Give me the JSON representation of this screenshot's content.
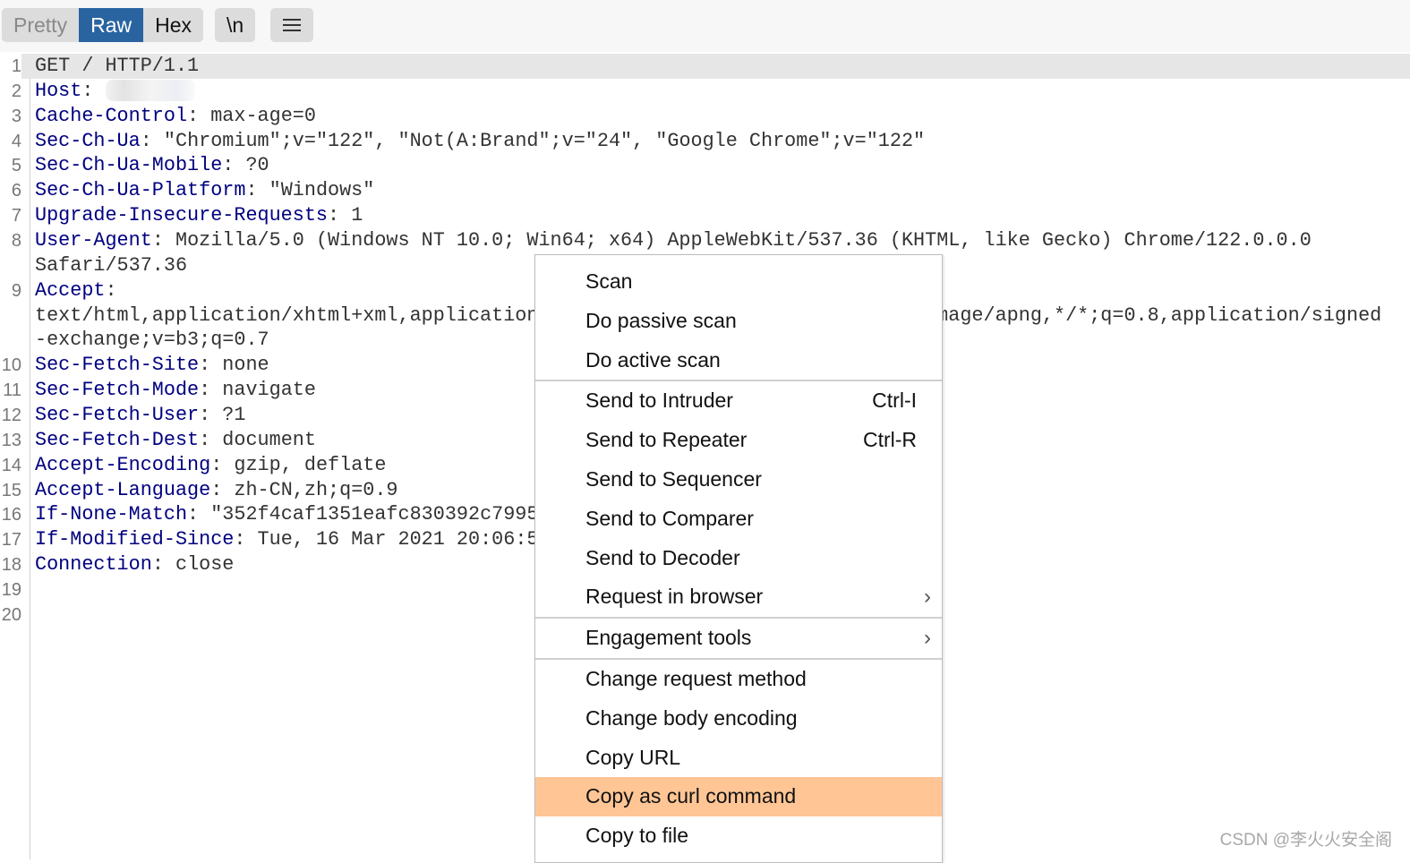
{
  "toolbar": {
    "tabs": [
      {
        "label": "Pretty",
        "active": false
      },
      {
        "label": "Raw",
        "active": true
      },
      {
        "label": "Hex",
        "active": false
      }
    ],
    "newline_label": "\\n",
    "menu_icon": "hamburger-icon"
  },
  "editor": {
    "rows": [
      {
        "num": "1",
        "key": "",
        "sep": "",
        "val": "GET / HTTP/1.1"
      },
      {
        "num": "2",
        "key": "Host",
        "sep": ":",
        "val": "",
        "redacted": true
      },
      {
        "num": "3",
        "key": "Cache-Control",
        "sep": ": ",
        "val": "max-age=0"
      },
      {
        "num": "4",
        "key": "Sec-Ch-Ua",
        "sep": ": ",
        "val": "\"Chromium\";v=\"122\", \"Not(A:Brand\";v=\"24\", \"Google Chrome\";v=\"122\""
      },
      {
        "num": "5",
        "key": "Sec-Ch-Ua-Mobile",
        "sep": ": ",
        "val": "?0"
      },
      {
        "num": "6",
        "key": "Sec-Ch-Ua-Platform",
        "sep": ": ",
        "val": "\"Windows\""
      },
      {
        "num": "7",
        "key": "Upgrade-Insecure-Requests",
        "sep": ": ",
        "val": "1"
      },
      {
        "num": "8",
        "key": "User-Agent",
        "sep": ": ",
        "val": "Mozilla/5.0 (Windows NT 10.0; Win64; x64) AppleWebKit/537.36 (KHTML, like Gecko) Chrome/122.0.0.0"
      },
      {
        "num": "",
        "key": "",
        "sep": "",
        "val": "Safari/537.36"
      },
      {
        "num": "9",
        "key": "Accept",
        "sep": ":",
        "val": ""
      },
      {
        "num": "",
        "key": "",
        "sep": "",
        "val": "text/html,application/xhtml+xml,application/xml;q=0.9,image/avif,image/webp,image/apng,*/*;q=0.8,application/signed"
      },
      {
        "num": "",
        "key": "",
        "sep": "",
        "val": "-exchange;v=b3;q=0.7"
      },
      {
        "num": "10",
        "key": "Sec-Fetch-Site",
        "sep": ": ",
        "val": "none"
      },
      {
        "num": "11",
        "key": "Sec-Fetch-Mode",
        "sep": ": ",
        "val": "navigate"
      },
      {
        "num": "12",
        "key": "Sec-Fetch-User",
        "sep": ": ",
        "val": "?1"
      },
      {
        "num": "13",
        "key": "Sec-Fetch-Dest",
        "sep": ": ",
        "val": "document"
      },
      {
        "num": "14",
        "key": "Accept-Encoding",
        "sep": ": ",
        "val": "gzip, deflate"
      },
      {
        "num": "15",
        "key": "Accept-Language",
        "sep": ": ",
        "val": "zh-CN,zh;q=0.9"
      },
      {
        "num": "16",
        "key": "If-None-Match",
        "sep": ": ",
        "val": "\"352f4caf1351eafc830392c7995"
      },
      {
        "num": "17",
        "key": "If-Modified-Since",
        "sep": ": ",
        "val": "Tue, 16 Mar 2021 20:06:5"
      },
      {
        "num": "18",
        "key": "Connection",
        "sep": ": ",
        "val": "close"
      },
      {
        "num": "19",
        "key": "",
        "sep": "",
        "val": ""
      },
      {
        "num": "20",
        "key": "",
        "sep": "",
        "val": ""
      }
    ]
  },
  "context_menu": {
    "items": [
      {
        "label": "Scan"
      },
      {
        "label": "Do passive scan"
      },
      {
        "label": "Do active scan",
        "separator_after": true
      },
      {
        "label": "Send to Intruder",
        "shortcut": "Ctrl-I"
      },
      {
        "label": "Send to Repeater",
        "shortcut": "Ctrl-R"
      },
      {
        "label": "Send to Sequencer"
      },
      {
        "label": "Send to Comparer"
      },
      {
        "label": "Send to Decoder"
      },
      {
        "label": "Request in browser",
        "submenu": true,
        "separator_after": true
      },
      {
        "label": "Engagement tools",
        "submenu": true,
        "separator_after": true
      },
      {
        "label": "Change request method"
      },
      {
        "label": "Change body encoding"
      },
      {
        "label": "Copy URL"
      },
      {
        "label": "Copy as curl command",
        "highlighted": true
      },
      {
        "label": "Copy to file"
      }
    ],
    "highlight_color": "#ffc595"
  },
  "watermark": "CSDN @李火火安全阁",
  "colors": {
    "header_key": "#000080",
    "active_tab": "#2a64a0"
  }
}
